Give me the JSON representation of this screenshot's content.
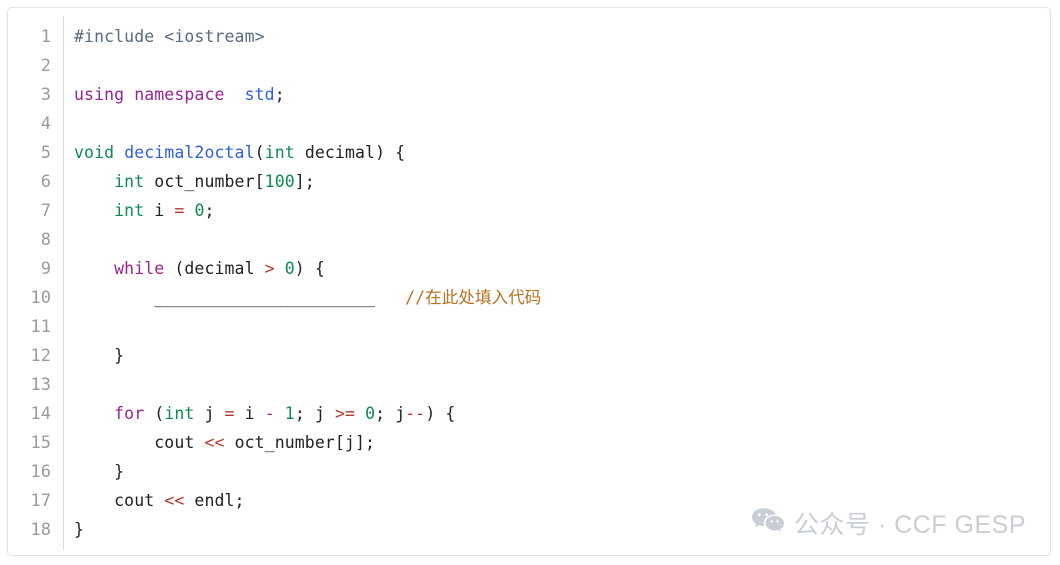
{
  "editor": {
    "language": "cpp",
    "total_lines": 18,
    "gutter_color": "#9b9b9b",
    "background": "#ffffff",
    "border_color": "#dfe4ea",
    "lines": [
      {
        "n": "1",
        "tokens": [
          {
            "t": "#include <iostream>",
            "c": "t-pre"
          }
        ]
      },
      {
        "n": "2",
        "tokens": []
      },
      {
        "n": "3",
        "tokens": [
          {
            "t": "using namespace",
            "c": "t-kw"
          },
          {
            "t": "  ",
            "c": "t-plain"
          },
          {
            "t": "std",
            "c": "t-ns"
          },
          {
            "t": ";",
            "c": "t-plain"
          }
        ]
      },
      {
        "n": "4",
        "tokens": []
      },
      {
        "n": "5",
        "tokens": [
          {
            "t": "void",
            "c": "t-type"
          },
          {
            "t": " ",
            "c": "t-plain"
          },
          {
            "t": "decimal2octal",
            "c": "t-fn"
          },
          {
            "t": "(",
            "c": "t-plain"
          },
          {
            "t": "int",
            "c": "t-type"
          },
          {
            "t": " decimal) {",
            "c": "t-plain"
          }
        ]
      },
      {
        "n": "6",
        "tokens": [
          {
            "t": "    ",
            "c": "t-plain"
          },
          {
            "t": "int",
            "c": "t-type"
          },
          {
            "t": " oct_number[",
            "c": "t-plain"
          },
          {
            "t": "100",
            "c": "t-num"
          },
          {
            "t": "];",
            "c": "t-plain"
          }
        ]
      },
      {
        "n": "7",
        "tokens": [
          {
            "t": "    ",
            "c": "t-plain"
          },
          {
            "t": "int",
            "c": "t-type"
          },
          {
            "t": " i ",
            "c": "t-plain"
          },
          {
            "t": "=",
            "c": "t-op"
          },
          {
            "t": " ",
            "c": "t-plain"
          },
          {
            "t": "0",
            "c": "t-num"
          },
          {
            "t": ";",
            "c": "t-plain"
          }
        ]
      },
      {
        "n": "8",
        "tokens": []
      },
      {
        "n": "9",
        "tokens": [
          {
            "t": "    ",
            "c": "t-plain"
          },
          {
            "t": "while",
            "c": "t-kw"
          },
          {
            "t": " (decimal ",
            "c": "t-plain"
          },
          {
            "t": ">",
            "c": "t-op"
          },
          {
            "t": " ",
            "c": "t-plain"
          },
          {
            "t": "0",
            "c": "t-num"
          },
          {
            "t": ") {",
            "c": "t-plain"
          }
        ]
      },
      {
        "n": "10",
        "tokens": [
          {
            "t": "        ",
            "c": "t-plain"
          },
          {
            "t": "______________________",
            "c": "t-blank"
          },
          {
            "t": "   ",
            "c": "t-plain"
          },
          {
            "t": "//在此处填入代码",
            "c": "t-cmt"
          }
        ]
      },
      {
        "n": "11",
        "tokens": []
      },
      {
        "n": "12",
        "tokens": [
          {
            "t": "    }",
            "c": "t-plain"
          }
        ]
      },
      {
        "n": "13",
        "tokens": []
      },
      {
        "n": "14",
        "tokens": [
          {
            "t": "    ",
            "c": "t-plain"
          },
          {
            "t": "for",
            "c": "t-kw"
          },
          {
            "t": " (",
            "c": "t-plain"
          },
          {
            "t": "int",
            "c": "t-type"
          },
          {
            "t": " j ",
            "c": "t-plain"
          },
          {
            "t": "=",
            "c": "t-op"
          },
          {
            "t": " i ",
            "c": "t-plain"
          },
          {
            "t": "-",
            "c": "t-op"
          },
          {
            "t": " ",
            "c": "t-plain"
          },
          {
            "t": "1",
            "c": "t-num"
          },
          {
            "t": "; j ",
            "c": "t-plain"
          },
          {
            "t": ">=",
            "c": "t-op"
          },
          {
            "t": " ",
            "c": "t-plain"
          },
          {
            "t": "0",
            "c": "t-num"
          },
          {
            "t": "; j",
            "c": "t-plain"
          },
          {
            "t": "--",
            "c": "t-op"
          },
          {
            "t": ") {",
            "c": "t-plain"
          }
        ]
      },
      {
        "n": "15",
        "tokens": [
          {
            "t": "        cout ",
            "c": "t-plain"
          },
          {
            "t": "<<",
            "c": "t-op"
          },
          {
            "t": " oct_number[j];",
            "c": "t-plain"
          }
        ]
      },
      {
        "n": "16",
        "tokens": [
          {
            "t": "    }",
            "c": "t-plain"
          }
        ]
      },
      {
        "n": "17",
        "tokens": [
          {
            "t": "    cout ",
            "c": "t-plain"
          },
          {
            "t": "<<",
            "c": "t-op"
          },
          {
            "t": " endl;",
            "c": "t-plain"
          }
        ]
      },
      {
        "n": "18",
        "tokens": [
          {
            "t": "}",
            "c": "t-plain"
          }
        ]
      }
    ],
    "plain_source": "#include <iostream>\n\nusing namespace  std;\n\nvoid decimal2octal(int decimal) {\n    int oct_number[100];\n    int i = 0;\n\n    while (decimal > 0) {\n        ______________________   //在此处填入代码\n\n    }\n\n    for (int j = i - 1; j >= 0; j--) {\n        cout << oct_number[j];\n    }\n    cout << endl;\n}"
  },
  "watermark": {
    "icon": "wechat-icon",
    "text": "公众号 · CCF GESP",
    "color": "#c9ced6"
  }
}
